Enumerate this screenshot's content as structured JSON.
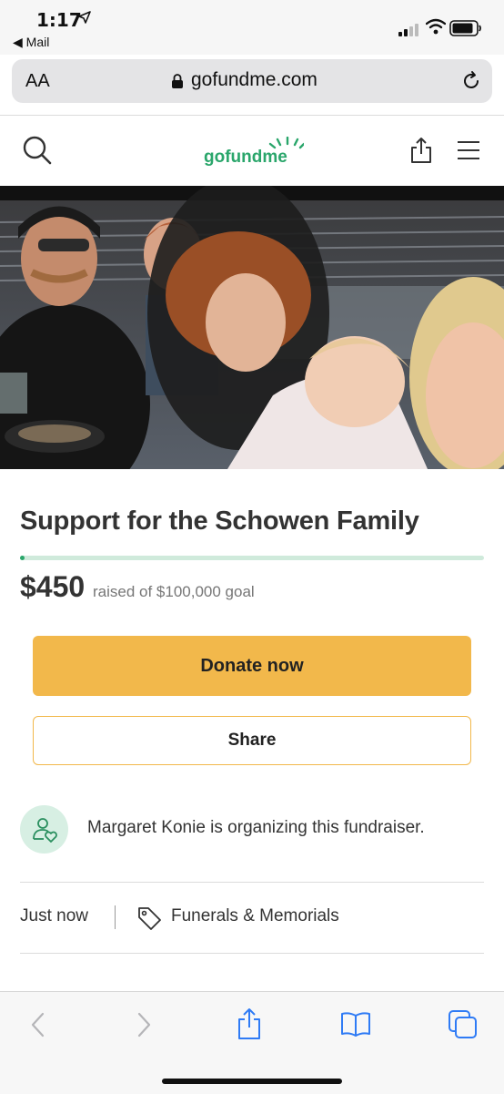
{
  "status": {
    "time": "1:17",
    "back_app": "Mail"
  },
  "browser": {
    "aa_label": "AA",
    "domain": "gofundme.com"
  },
  "site": {
    "logo_text": "gofundme",
    "brand_color": "#2aa66b"
  },
  "campaign": {
    "title": "Support for the Schowen Family",
    "raised": "$450",
    "goal_text": "raised of $100,000 goal",
    "progress_fraction": 0.0045,
    "donate_label": "Donate now",
    "share_label": "Share",
    "organizer_text": "Margaret Konie is organizing this fundraiser.",
    "created": "Just now",
    "category": "Funerals & Memorials"
  },
  "colors": {
    "accent": "#f2b84b",
    "progress_track": "#cfeadb",
    "progress_fill": "#2aa66b"
  },
  "icons": {
    "location": "location-arrow-icon",
    "signal": "cellular-signal-icon",
    "wifi": "wifi-icon",
    "battery": "battery-icon",
    "lock": "lock-icon",
    "reload": "reload-icon",
    "search": "search-icon",
    "share": "share-icon",
    "menu": "hamburger-menu-icon",
    "organizer": "user-heart-icon",
    "tag": "tag-icon",
    "back": "chevron-left-icon",
    "forward": "chevron-right-icon",
    "bookmarks": "book-icon",
    "tabs": "tabs-icon"
  }
}
